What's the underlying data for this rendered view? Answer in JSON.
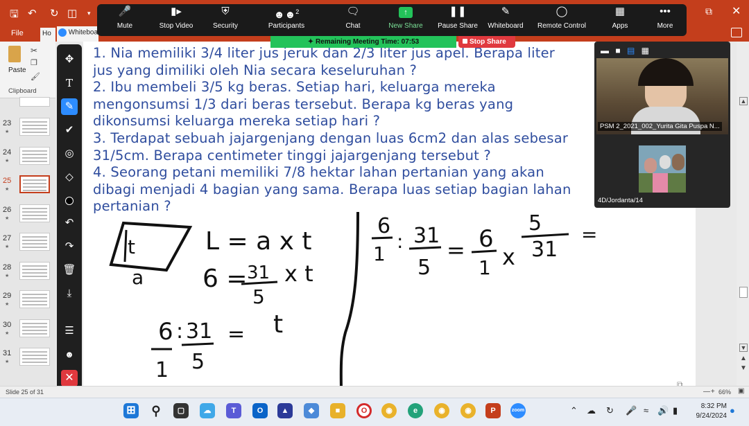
{
  "ppt": {
    "tabs": {
      "file": "File",
      "home": "Ho"
    },
    "ribbon": {
      "paste": "Paste",
      "clipboard": "Clipboard"
    },
    "slide_numbers": [
      "23",
      "24",
      "25",
      "26",
      "27",
      "28",
      "29",
      "30",
      "31"
    ],
    "active_slide": "25",
    "status": {
      "slide_of": "Slide 25 of 31",
      "zoom": "66%"
    }
  },
  "zoom": {
    "whiteboard_tab": "Whiteboa",
    "toolbar": {
      "mute": "Mute",
      "stop_video": "Stop Video",
      "security": "Security",
      "participants": "Participants",
      "participant_count": "2",
      "chat": "Chat",
      "new_share": "New Share",
      "pause_share": "Pause Share",
      "whiteboard": "Whiteboard",
      "remote_control": "Remote Control",
      "apps": "Apps",
      "more": "More"
    },
    "timer": "Remaining Meeting Time: 07:53",
    "stop_share": "Stop Share",
    "video": {
      "main_name": "PSM 2_2021_002_Yurita Gita Puspa N...",
      "second_name": "4D/Jordanta/14"
    },
    "annotation_tools": [
      "move",
      "text",
      "pen",
      "check",
      "spotlight",
      "eraser",
      "color",
      "undo",
      "redo",
      "delete",
      "save",
      "menu",
      "people",
      "stop"
    ]
  },
  "slide": {
    "lines": [
      "1. Nia memiliki 3/4 liter jus jeruk dan 2/3 liter jus apel. Berapa liter",
      "jus yang dimiliki oleh Nia secara keseluruhan ?",
      "2. Ibu membeli 3/5 kg beras. Setiap hari, keluarga mereka",
      "mengonsumsi 1/3 dari beras tersebut. Berapa kg beras yang",
      "dikonsumsi keluarga mereka setiap hari ?",
      "3. Terdapat sebuah jajargenjang dengan luas 6cm2 dan alas sebesar",
      "31/5cm. Berapa centimeter tinggi jajargenjang tersebut ?",
      "4. Seorang petani memiliki 7/8 hektar lahan pertanian yang akan",
      "dibagi menjadi 4 bagian yang sama. Berapa luas setiap bagian lahan",
      "pertanian ?"
    ],
    "handwriting": {
      "shape_label_t": "t",
      "shape_label_a": "a",
      "formula": "L = a x t",
      "step1_left": "6 =",
      "step1_num": "31",
      "step1_den": "5",
      "step1_right": "x t",
      "step2_a_num": "6",
      "step2_a_den": "1",
      "step2_div": ":",
      "step2_b_num": "31",
      "step2_b_den": "5",
      "step2_eq": "=",
      "step2_result": "t",
      "right_a_num": "6",
      "right_a_den": "1",
      "right_div": ":",
      "right_b_num": "31",
      "right_b_den": "5",
      "right_eq": "=",
      "right_c_num": "6",
      "right_c_den": "1",
      "right_times": "x",
      "right_d_num": "5",
      "right_d_den": "31",
      "right_eq2": "="
    }
  },
  "taskbar": {
    "time": "8:32 PM",
    "date": "9/24/2024"
  }
}
